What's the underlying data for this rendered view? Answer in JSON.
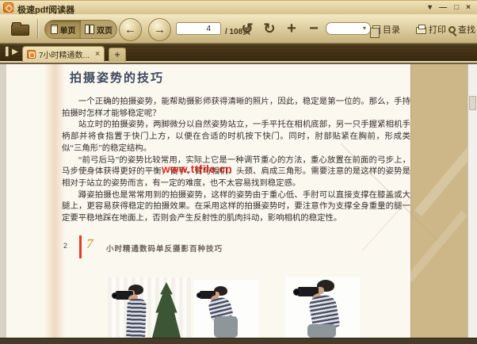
{
  "colors": {
    "titlebar_tan": "#e6d6a8",
    "toolbar_icon_brown": "#55421f",
    "tabbar_brown": "#7c6b47",
    "active_tab_tan": "#ead9ac",
    "app_icon_orange": "#e8821e",
    "page_bg": "#fbf8f0",
    "page_edge_khaki": "#cdb687",
    "heading_navy": "#3e4a60",
    "watermark_red": "#e30b00",
    "footer_bar_red": "#e23b2e",
    "footer_numeral_orange": "#d98a2b"
  },
  "window": {
    "title": "极速pdf阅读器",
    "controls": {
      "menu": "▾",
      "minimize": "—",
      "maximize": "□",
      "close": "×"
    }
  },
  "toolbar": {
    "single_page_label": "单页",
    "double_page_label": "双页",
    "page_input_value": "4",
    "page_total_label": "/ 108页",
    "toc_label": "目录",
    "print_label": "打印",
    "search_label": "查找"
  },
  "icons": {
    "back": "←",
    "forward": "→",
    "rotate_left": "↺",
    "rotate_right": "↻",
    "zoom_in": "+",
    "zoom_out": "−",
    "combo_arrow": "▾",
    "sidebar_toggle": "▌▶",
    "tab_close": "×",
    "new_tab": "+"
  },
  "tabbar": {
    "active_tab_title": "7小时精通数..."
  },
  "document": {
    "heading": "拍摄姿势的技巧",
    "paragraphs": [
      "一个正确的拍摄姿势，能帮助摄影师获得清晰的照片，因此，稳定是第一位的。那么，手持拍摄时怎样才能够稳定呢？",
      "站立时的拍摄姿势，两脚微分以自然姿势站立，一手平托在相机底部，另一只手握紧相机手柄部并将食指置于快门上方，以便在合适的时机按下快门。同时，肘部贴紧在胸前，形成类似“三角形”的稳定结构。",
      "“前弓后马”的姿势比较常用，实际上它是一种调节重心的方法，重心放置在前面的弓步上，马步使身体获得更好的平衡，使手、臂与相机、头颈、肩成三角形。需要注意的是这样的姿势是相对于站立的姿势而言，有一定的难度，也不太容易找到稳定感。",
      "蹲姿拍摄也是常常用到的拍摄姿势，这样的姿势由于重心低、手肘可以直接支撑在膝盖或大腿上，更容易获得稳定的拍摄效果。在采用这样的拍摄姿势时，要注意作为支撑全身重量的腿一定要平稳地踩在地面上，否则会产生反射性的肌肉抖动，影响相机的稳定性。"
    ],
    "watermark": "www.ttfile.cn",
    "footer": {
      "page_number": "2",
      "series_number": "7",
      "book_title": "小时精通数码单反摄影百种技巧"
    }
  }
}
